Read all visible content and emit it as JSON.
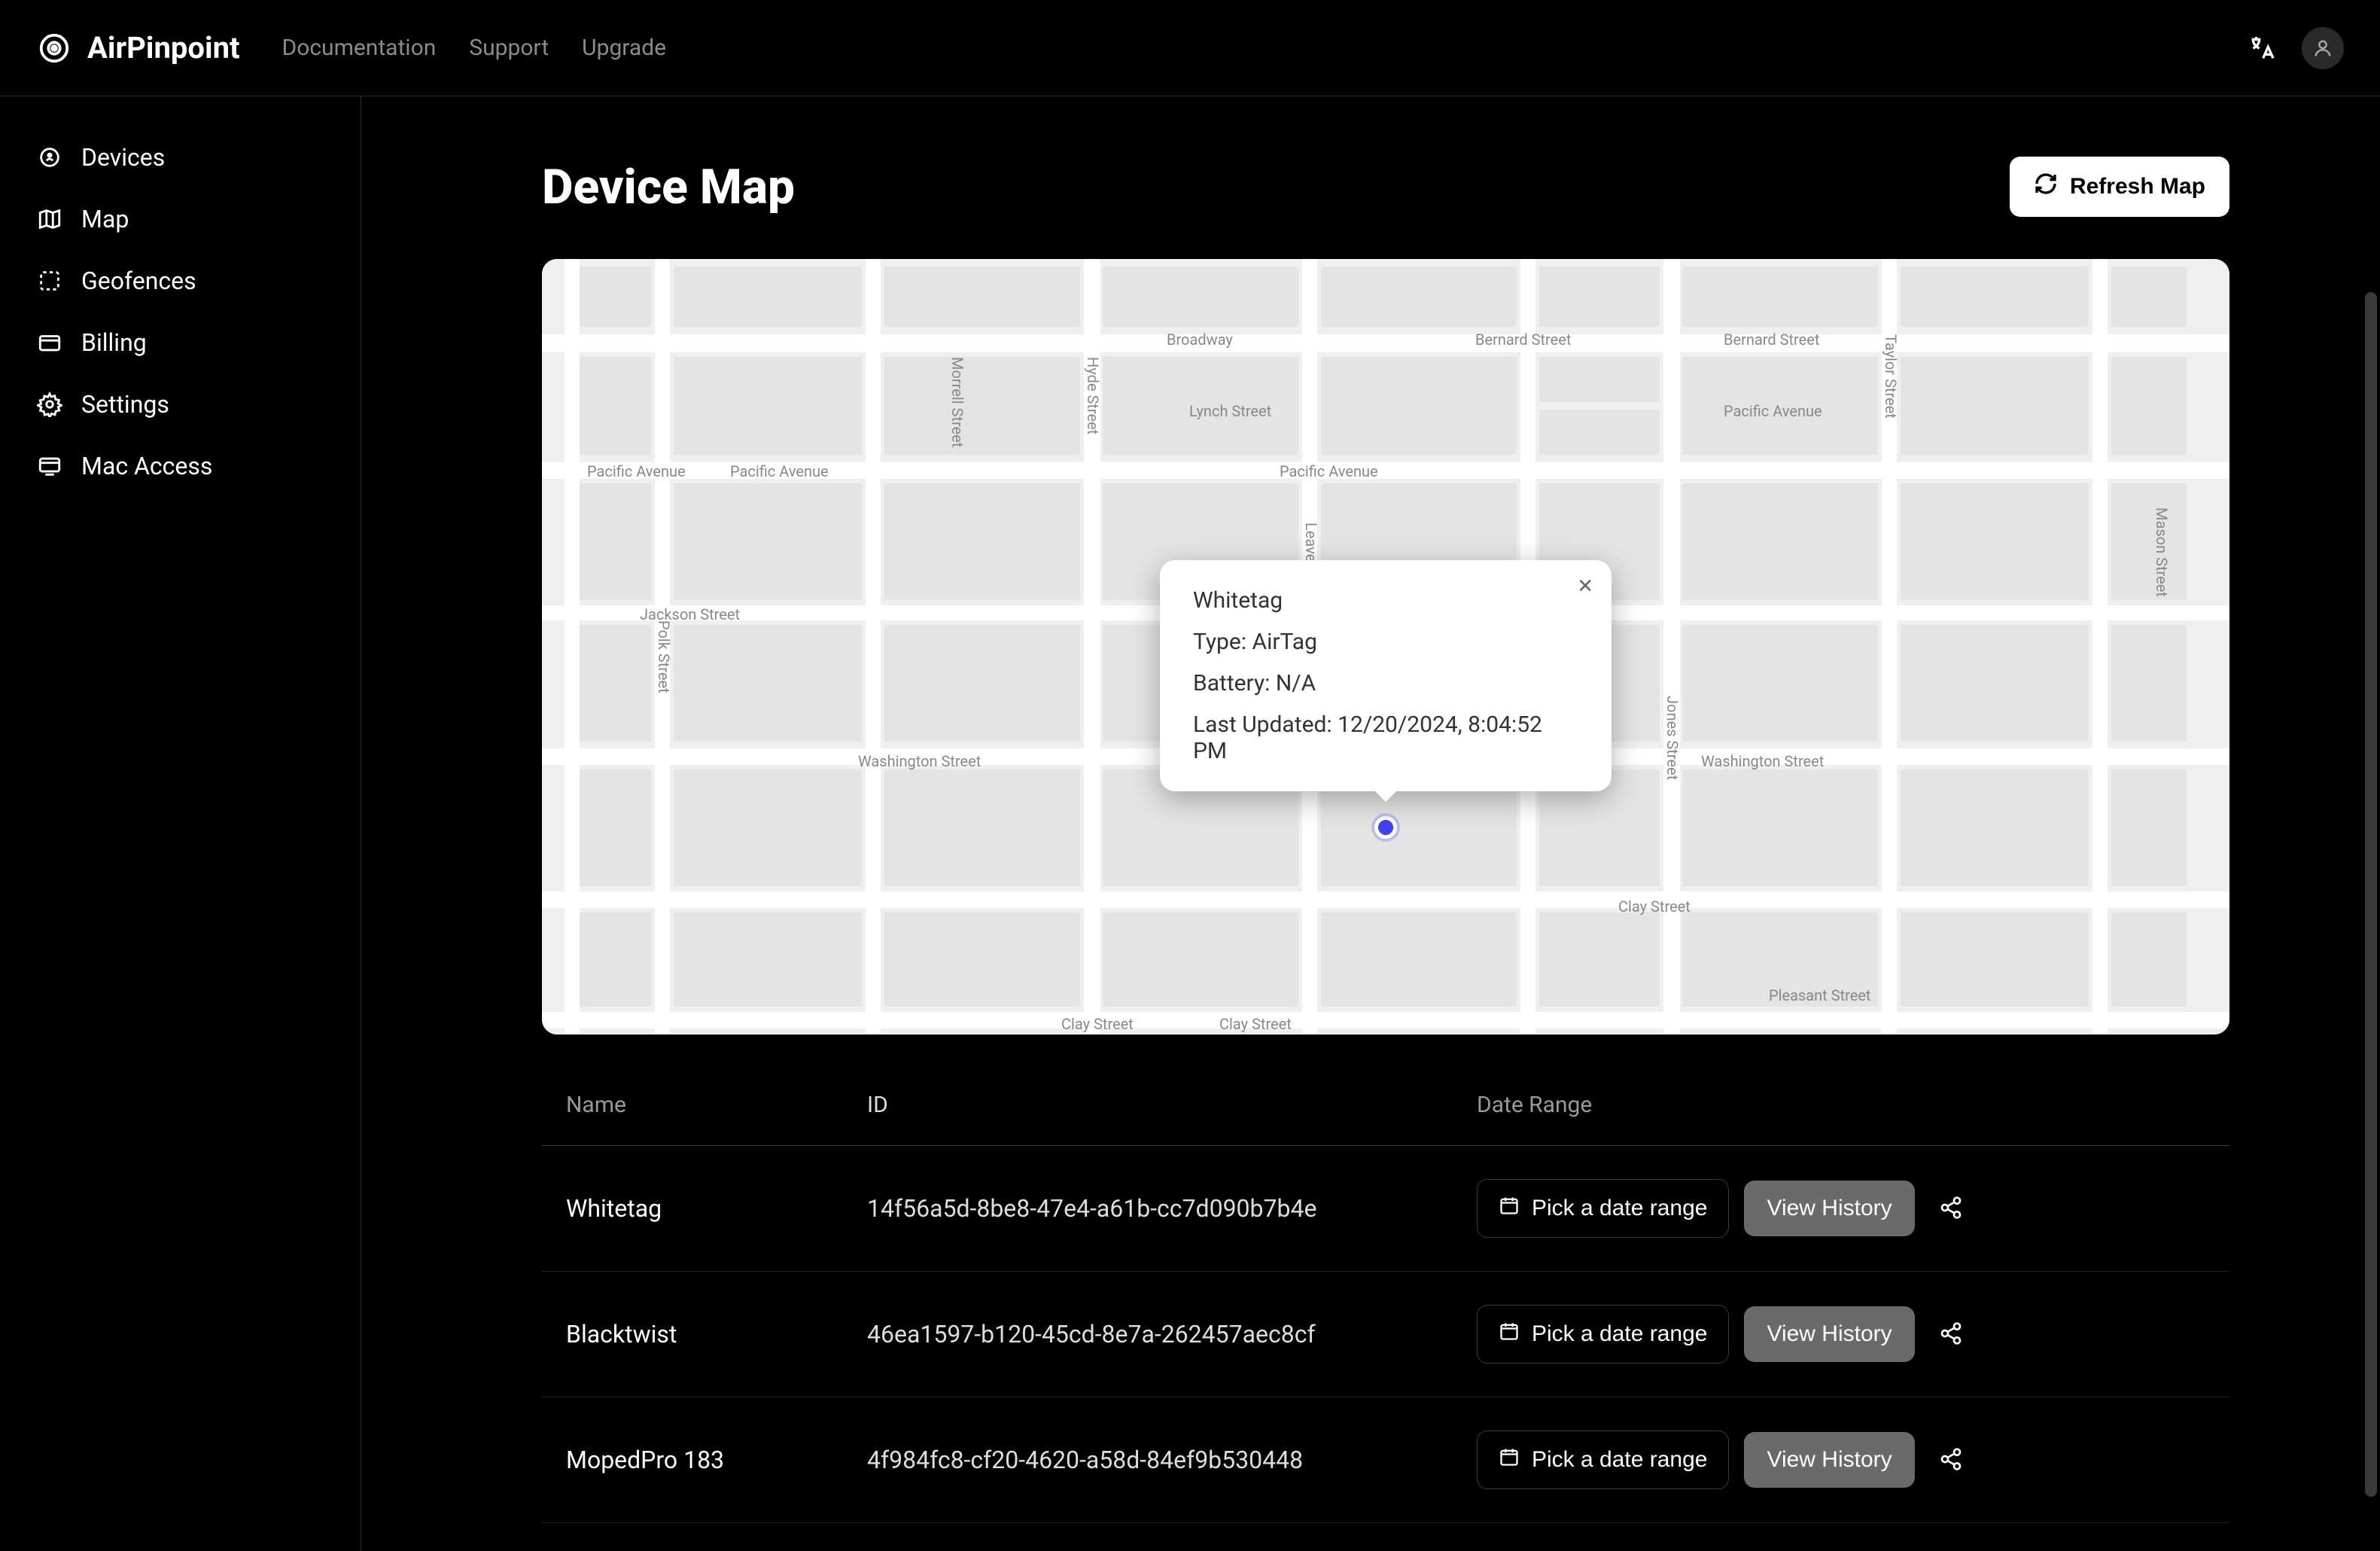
{
  "brand": {
    "name": "AirPinpoint"
  },
  "headerNav": {
    "documentation": "Documentation",
    "support": "Support",
    "upgrade": "Upgrade"
  },
  "sidebar": {
    "devices": "Devices",
    "map": "Map",
    "geofences": "Geofences",
    "billing": "Billing",
    "settings": "Settings",
    "macaccess": "Mac Access"
  },
  "page": {
    "title": "Device Map",
    "refreshLabel": "Refresh Map"
  },
  "popup": {
    "name": "Whitetag",
    "typeLabel": "Type: AirTag",
    "batteryLabel": "Battery: N/A",
    "updatedLabel": "Last Updated: 12/20/2024, 8:04:52 PM"
  },
  "mapLabels": {
    "broadway": "Broadway",
    "pacific1": "Pacific Avenue",
    "pacific2": "Pacific Avenue",
    "pacific3": "Pacific Avenue",
    "bernard1": "Bernard Street",
    "bernard2": "Bernard Street",
    "lynch": "Lynch Street",
    "jackson": "Jackson Street",
    "washington1": "Washington Street",
    "washington2": "Washington Street",
    "washington3": "Washington Street",
    "clay1": "Clay Street",
    "clay2": "Clay Street",
    "clay3": "Clay Street",
    "pleasant": "Pleasant Street",
    "polk": "Polk Street",
    "morrell": "Morrell Street",
    "hyde": "Hyde Street",
    "leavenworth": "Leavenworth Street",
    "jones": "Jones Street",
    "taylor": "Taylor Street",
    "mason": "Mason Street"
  },
  "table": {
    "headers": {
      "name": "Name",
      "id": "ID",
      "dateRange": "Date Range"
    },
    "dateBtnLabel": "Pick a date range",
    "historyBtnLabel": "View History",
    "rows": [
      {
        "name": "Whitetag",
        "id": "14f56a5d-8be8-47e4-a61b-cc7d090b7b4e"
      },
      {
        "name": "Blacktwist",
        "id": "46ea1597-b120-45cd-8e7a-262457aec8cf"
      },
      {
        "name": "MopedPro 183",
        "id": "4f984fc8-cf20-4620-a58d-84ef9b530448"
      }
    ]
  }
}
